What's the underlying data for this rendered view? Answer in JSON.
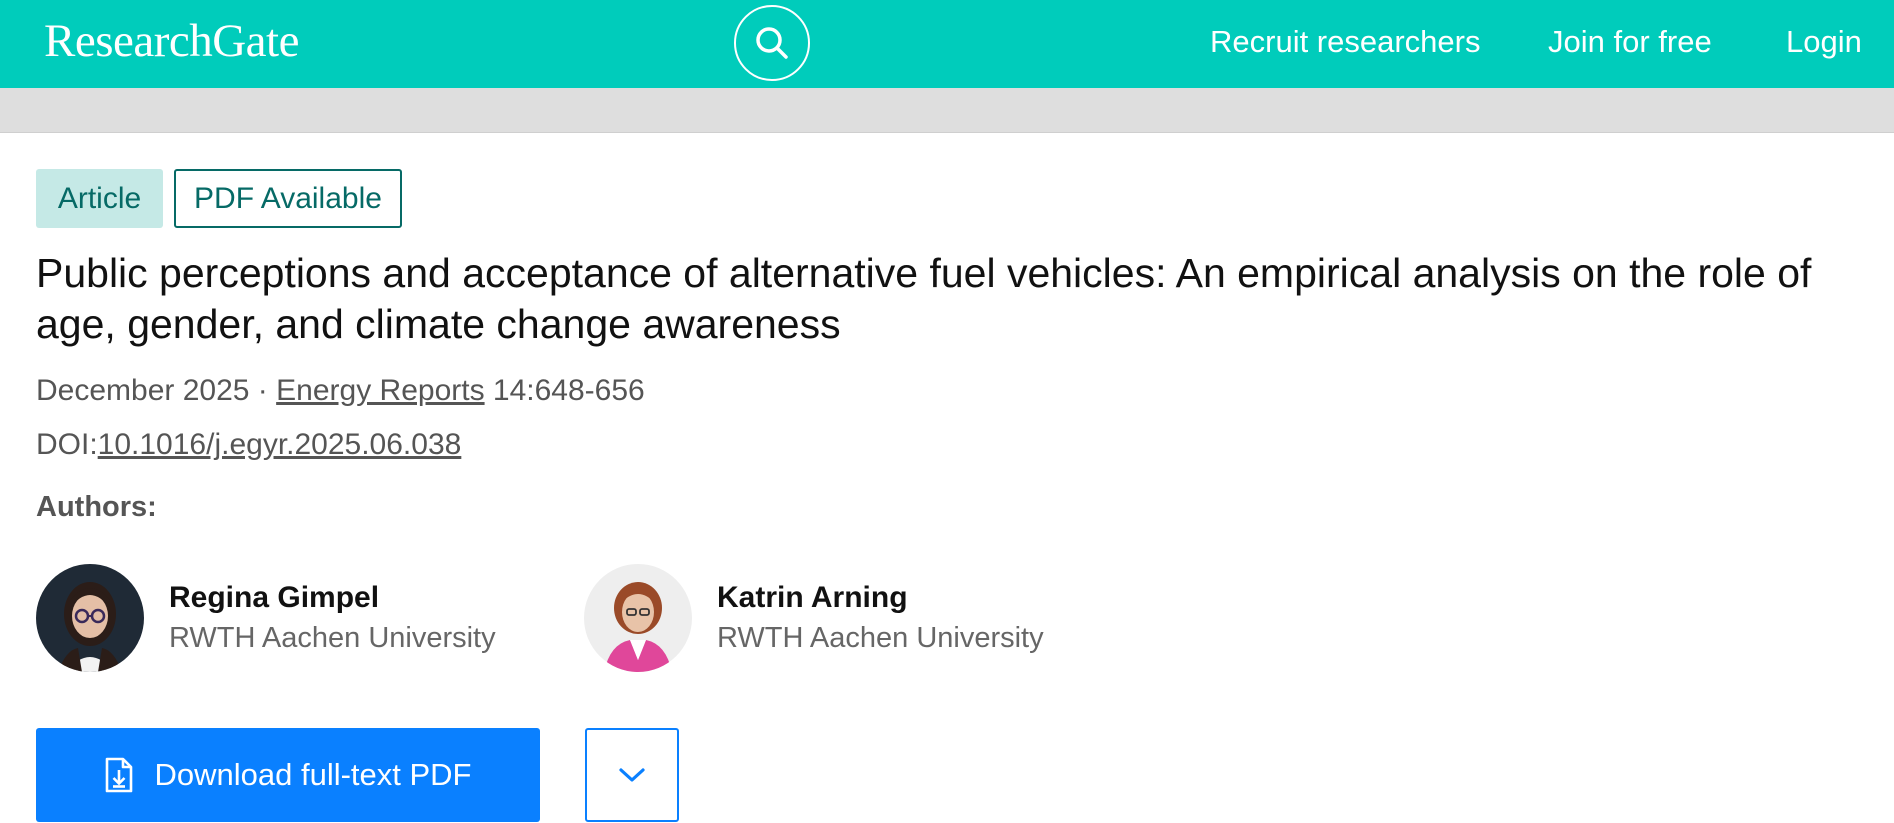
{
  "header": {
    "logo": "ResearchGate",
    "search_icon": "search-icon",
    "nav": {
      "recruit": "Recruit researchers",
      "join": "Join for free",
      "login": "Login"
    }
  },
  "colors": {
    "brand": "#00ccbb",
    "primary_button": "#0a80ff",
    "badge_bg": "#c5e9e6",
    "badge_text": "#066a66"
  },
  "article": {
    "badges": [
      "Article",
      "PDF Available"
    ],
    "title": "Public perceptions and acceptance of alternative fuel vehicles: An empirical analysis on the role of age, gender, and climate change awareness",
    "date": "December 2025",
    "separator": " · ",
    "journal": "Energy Reports",
    "pages": " 14:648-656",
    "doi_label": "DOI:",
    "doi": "10.1016/j.egyr.2025.06.038",
    "authors_label": "Authors:",
    "authors": [
      {
        "name": "Regina Gimpel",
        "institution": "RWTH Aachen University"
      },
      {
        "name": "Katrin Arning",
        "institution": "RWTH Aachen University"
      }
    ]
  },
  "actions": {
    "download_label": "Download full-text PDF",
    "download_icon": "file-download-icon",
    "more_icon": "chevron-down-icon"
  }
}
